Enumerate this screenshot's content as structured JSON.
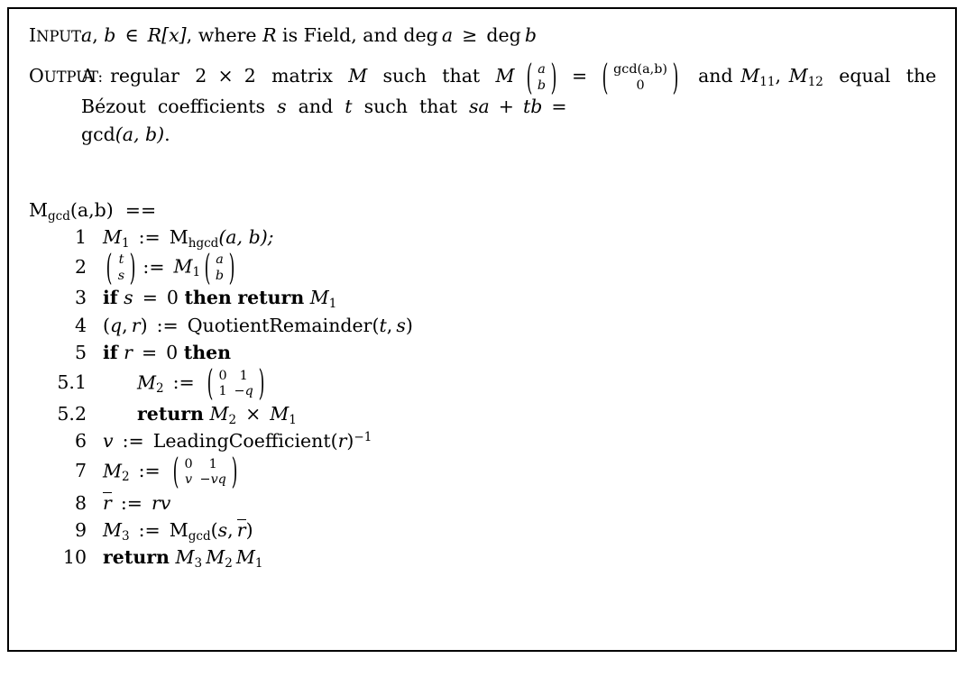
{
  "document": {
    "kind": "algorithm-pseudocode-box",
    "border_color": "#000000",
    "background_color": "#ffffff",
    "text_color": "#000000"
  },
  "input_spec": {
    "label": "Input:",
    "label_first_letter": "I",
    "label_rest": "NPUT:",
    "text_plain": "a, b ∈ R[x], where R is Field, and deg a ≥ deg b",
    "variables": [
      "a",
      "b"
    ],
    "ring": "R[x]",
    "ring_symbol": "R",
    "ring_kind": "Field",
    "condition": "deg a ≥ deg b",
    "tokens": {
      "a": "a",
      "comma": ",",
      "b": "b",
      "in": "∈",
      "R": "R",
      "bracket_x": "[x]",
      "where": "where",
      "is": "is",
      "field": "Field",
      "and": "and",
      "deg": "deg",
      "geq": "≥"
    }
  },
  "output_spec": {
    "label": "Output:",
    "label_first_letter": "O",
    "label_rest": "UTPUT:",
    "text_plain": "A regular 2 × 2 matrix M such that M (a/b) = (gcd(a,b)/0) and M11, M12 equal the Bézout coefficients s and t such that sa + tb = gcd(a, b).",
    "line1": {
      "a_word": "A",
      "regular": "regular",
      "dim_left": "2",
      "times": "×",
      "dim_right": "2",
      "matrix_word": "matrix",
      "M": "M",
      "such": "such",
      "that": "that",
      "equals": "=",
      "and": "and",
      "vector_ab": [
        "a",
        "b"
      ],
      "vector_gcd": [
        "gcd(a,b)",
        "0"
      ]
    },
    "line2": {
      "M11": "M",
      "M11_sub": "11",
      "M12": "M",
      "M12_sub": "12",
      "equal": "equal",
      "the": "the",
      "bezout": "Bézout",
      "coefficients": "coefficients",
      "s": "s",
      "and": "and",
      "t": "t",
      "such": "such",
      "that": "that",
      "sa": "sa",
      "plus": "+",
      "tb": "tb",
      "equals": "="
    },
    "line3": {
      "gcd": "gcd",
      "args": "(a, b)",
      "period": "."
    }
  },
  "algorithm": {
    "name_plain": "M_gcd(a,b)",
    "name_main": "M",
    "name_sub": "gcd",
    "name_args": "(a,b)",
    "defines_operator": "==",
    "steps": [
      {
        "number": "1",
        "kind": "assignment",
        "indent": "normal",
        "plain": "M1 := Mhgcd(a, b);",
        "lhs": "M",
        "lhs_sub": "1",
        "assign": ":=",
        "rhs_fn": "M",
        "rhs_fn_sub": "hgcd",
        "rhs_args": "(a, b);"
      },
      {
        "number": "2",
        "kind": "vector-assignment",
        "indent": "normal",
        "plain": "(t/s) := M1 (a/b)",
        "lhs_vector": [
          "t",
          "s"
        ],
        "assign": ":=",
        "rhs_matrix": "M",
        "rhs_matrix_sub": "1",
        "rhs_vector": [
          "a",
          "b"
        ]
      },
      {
        "number": "3",
        "kind": "conditional-return",
        "indent": "normal",
        "plain": "if s = 0 then return M1",
        "kw_if": "if",
        "var": "s",
        "eq": "=",
        "value": "0",
        "kw_then": "then",
        "kw_return": "return",
        "ret": "M",
        "ret_sub": "1"
      },
      {
        "number": "4",
        "kind": "assignment",
        "indent": "normal",
        "plain": "(q, r) := QuotientRemainder(t, s)",
        "lhs_tuple": [
          "q",
          "r"
        ],
        "assign": ":=",
        "fn": "QuotientRemainder",
        "args": [
          "t",
          "s"
        ]
      },
      {
        "number": "5",
        "kind": "conditional",
        "indent": "normal",
        "plain": "if r = 0 then",
        "kw_if": "if",
        "var": "r",
        "eq": "=",
        "value": "0",
        "kw_then": "then"
      },
      {
        "number": "5.1",
        "kind": "matrix-assignment",
        "indent": "deep",
        "plain": "M2 := (0 1 / 1 -q)",
        "lhs": "M",
        "lhs_sub": "2",
        "assign": ":=",
        "matrix": [
          [
            "0",
            "1"
          ],
          [
            "1",
            "−q"
          ]
        ]
      },
      {
        "number": "5.2",
        "kind": "return",
        "indent": "deep",
        "plain": "return M2 × M1",
        "kw_return": "return",
        "left": "M",
        "left_sub": "2",
        "times": "×",
        "right": "M",
        "right_sub": "1"
      },
      {
        "number": "6",
        "kind": "assignment",
        "indent": "normal",
        "plain": "v := LeadingCoefficient(r)^-1",
        "lhs": "v",
        "assign": ":=",
        "fn": "LeadingCoefficient",
        "arg": "r",
        "exponent": "−1"
      },
      {
        "number": "7",
        "kind": "matrix-assignment",
        "indent": "normal",
        "plain": "M2 := (0 1 / v -vq)",
        "lhs": "M",
        "lhs_sub": "2",
        "assign": ":=",
        "matrix": [
          [
            "0",
            "1"
          ],
          [
            "v",
            "−vq"
          ]
        ]
      },
      {
        "number": "8",
        "kind": "assignment",
        "indent": "normal",
        "plain": "r̄ := rv",
        "lhs_overline": "r",
        "assign": ":=",
        "rhs": "rv"
      },
      {
        "number": "9",
        "kind": "assignment",
        "indent": "normal",
        "plain": "M3 := Mgcd(s, r̄)",
        "lhs": "M",
        "lhs_sub": "3",
        "assign": ":=",
        "fn": "M",
        "fn_sub": "gcd",
        "arg1": "s",
        "arg2_overline": "r"
      },
      {
        "number": "10",
        "kind": "return",
        "indent": "normal",
        "plain": "return M3 M2 M1",
        "kw_return": "return",
        "m3": "M",
        "m3_sub": "3",
        "m2": "M",
        "m2_sub": "2",
        "m1": "M",
        "m1_sub": "1"
      }
    ]
  }
}
